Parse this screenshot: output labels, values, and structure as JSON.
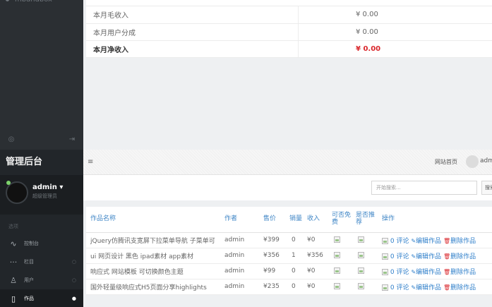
{
  "top_sidebar": {
    "brand_peek": "mbandbox"
  },
  "summary": {
    "rows": [
      {
        "label": "本月毛收入",
        "value": "¥ 0.00"
      },
      {
        "label": "本月用户分成",
        "value": "¥ 0.00"
      },
      {
        "label": "本月净收入",
        "value": "¥ 0.00"
      }
    ]
  },
  "sidebar": {
    "brand": "管理后台",
    "user": {
      "name": "admin",
      "role": "超级管理员"
    },
    "nav_title": "选项",
    "items": [
      {
        "icon": "∿",
        "label": "控制台"
      },
      {
        "icon": "···",
        "label": "栏目"
      },
      {
        "icon": "♙",
        "label": "用户"
      },
      {
        "icon": "▯",
        "label": "作品"
      }
    ]
  },
  "topbar": {
    "menu_icon": "≡",
    "site_home": "网站首页",
    "admin_peek": "admi"
  },
  "toolbar": {
    "search_placeholder": "开始搜索...",
    "search_btn": "搜索"
  },
  "works": {
    "headers": [
      "作品名称",
      "作者",
      "售价",
      "销量",
      "收入",
      "可否免费",
      "是否推荐",
      "操作"
    ],
    "rows": [
      {
        "title": "jQuery仿腾讯支宽屏下拉菜单导航 子菜单可",
        "author": "admin",
        "price": "¥399",
        "sales": "0",
        "income": "¥0"
      },
      {
        "title": "ui 网页设计 黑色 ipad素材 app素材",
        "author": "admin",
        "price": "¥356",
        "sales": "1",
        "income": "¥356"
      },
      {
        "title": "响应式 网站模板 可切换颜色主题",
        "author": "admin",
        "price": "¥99",
        "sales": "0",
        "income": "¥0"
      },
      {
        "title": "国外轻量级响应式H5页面分享highlights",
        "author": "admin",
        "price": "¥235",
        "sales": "0",
        "income": "¥0"
      }
    ],
    "ops": {
      "comment": "0 评论",
      "edit": "编辑作品",
      "delete": "删除作品"
    }
  }
}
